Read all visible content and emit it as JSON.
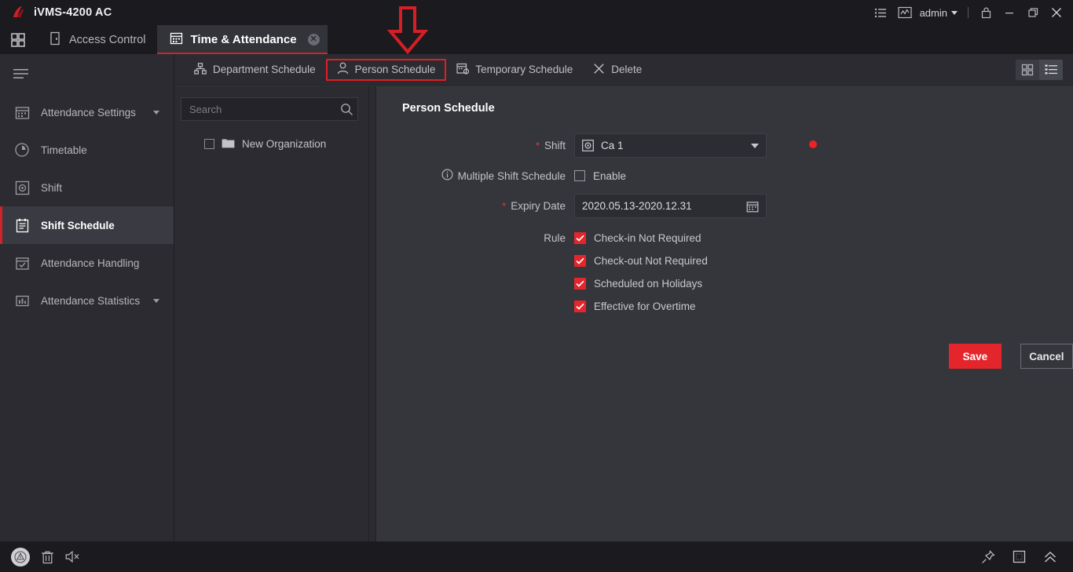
{
  "titlebar": {
    "app_title": "iVMS-4200 AC",
    "user": "admin",
    "icons": {
      "list": "list-icon",
      "stats": "statistics-icon",
      "lock": "lock-icon",
      "minimize": "minimize-icon",
      "maximize": "maximize-icon",
      "close": "close-icon"
    }
  },
  "tabbar": {
    "grid_button": "app-grid-icon",
    "tabs": [
      {
        "label": "Access Control",
        "icon": "door-icon",
        "active": false,
        "closable": false
      },
      {
        "label": "Time & Attendance",
        "icon": "calendar-icon",
        "active": true,
        "closable": true
      }
    ]
  },
  "sidebar": {
    "menu_icon": "hamburger-icon",
    "items": [
      {
        "label": "Attendance Settings",
        "icon": "calendar-settings-icon",
        "active": false,
        "expandable": true
      },
      {
        "label": "Timetable",
        "icon": "clock-icon",
        "active": false,
        "expandable": false
      },
      {
        "label": "Shift",
        "icon": "shift-icon",
        "active": false,
        "expandable": false
      },
      {
        "label": "Shift Schedule",
        "icon": "schedule-list-icon",
        "active": true,
        "expandable": false
      },
      {
        "label": "Attendance Handling",
        "icon": "calendar-check-icon",
        "active": false,
        "expandable": false
      },
      {
        "label": "Attendance Statistics",
        "icon": "chart-calendar-icon",
        "active": false,
        "expandable": true
      }
    ]
  },
  "toolbar": {
    "items": [
      {
        "label": "Department Schedule",
        "icon": "org-tree-icon",
        "highlighted": false
      },
      {
        "label": "Person Schedule",
        "icon": "person-icon",
        "highlighted": true
      },
      {
        "label": "Temporary Schedule",
        "icon": "temp-calendar-icon",
        "highlighted": false
      },
      {
        "label": "Delete",
        "icon": "close-x-icon",
        "highlighted": false
      }
    ],
    "view_grid": "grid-view-icon",
    "view_list": "list-view-icon"
  },
  "tree": {
    "search_placeholder": "Search",
    "search_value": "",
    "search_icon": "search-icon",
    "nodes": [
      {
        "label": "New Organization",
        "icon": "folder-icon",
        "checked": false
      }
    ]
  },
  "content": {
    "title": "Person Schedule",
    "fields": {
      "shift_label": "Shift",
      "shift_value": "Ca 1",
      "shift_icon": "shift-badge-icon",
      "shift_required": true,
      "multiple_shift_label": "Multiple Shift Schedule",
      "multiple_shift_info_icon": "info-icon",
      "multiple_shift_enable_label": "Enable",
      "multiple_shift_enabled": false,
      "expiry_label": "Expiry Date",
      "expiry_value": "2020.05.13-2020.12.31",
      "expiry_required": true,
      "expiry_icon": "calendar-picker-icon",
      "rule_label": "Rule"
    },
    "rules": [
      {
        "label": "Check-in Not Required",
        "checked": true
      },
      {
        "label": "Check-out Not Required",
        "checked": true
      },
      {
        "label": "Scheduled on Holidays",
        "checked": true
      },
      {
        "label": "Effective for Overtime",
        "checked": true
      }
    ],
    "buttons": {
      "save": "Save",
      "cancel": "Cancel"
    }
  },
  "statusbar": {
    "left_icons": [
      "alert-warning-icon",
      "trash-icon",
      "speaker-muted-icon"
    ],
    "right_icons": [
      "pin-icon",
      "square-icon",
      "chevron-double-up-icon"
    ]
  },
  "annotations": {
    "arrow": "red-down-arrow",
    "dot": "red-dot",
    "highlight_box": "red-rectangle-person-schedule"
  },
  "colors": {
    "accent_red": "#e4262c",
    "annotation_red": "#e02020",
    "bg_dark": "#1b1b1f",
    "bg_panel": "#2b2b31",
    "bg_content": "#35353c"
  }
}
